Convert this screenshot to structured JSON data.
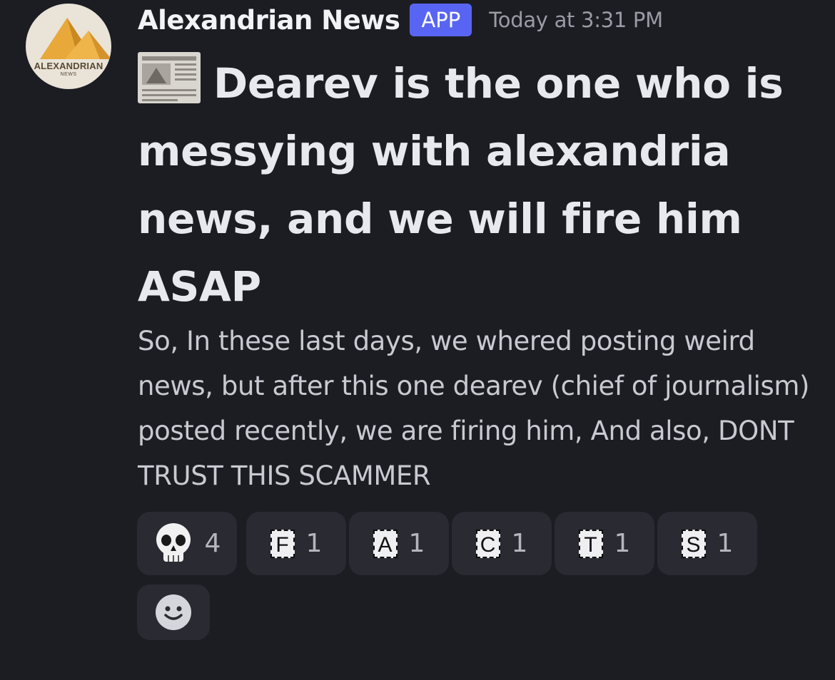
{
  "author": {
    "name": "Alexandrian News",
    "badge": "APP",
    "timestamp": "Today at 3:31 PM",
    "avatar_title": "ALEXANDRIAN",
    "avatar_subtitle": "NEWS",
    "avatar_icon": "pyramids-logo"
  },
  "message": {
    "title_icon": "newspaper-emoji",
    "title": "Dearev is the one who is messying with alexandria news, and we will fire him ASAP",
    "body": "So, In these last days, we whered posting weird news, but after this one dearev (chief of journalism) posted recently, we are firing him, And also, DONT TRUST THIS SCAMMER"
  },
  "reactions": [
    {
      "emoji": "skull-emoji",
      "count": "4"
    },
    {
      "letter": "F",
      "count": "1"
    },
    {
      "letter": "A",
      "count": "1"
    },
    {
      "letter": "C",
      "count": "1"
    },
    {
      "letter": "T",
      "count": "1"
    },
    {
      "letter": "S",
      "count": "1"
    }
  ],
  "add_reaction_icon": "smiley-add-reaction-icon",
  "colors": {
    "background": "#1c1d23",
    "badge": "#5865f2",
    "reaction_bg": "#292a32"
  }
}
